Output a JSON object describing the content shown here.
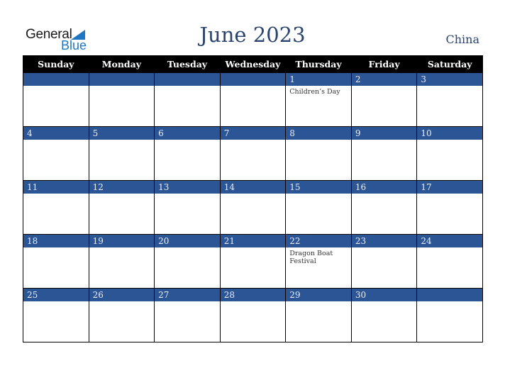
{
  "logo": {
    "line1": "General",
    "line2": "Blue"
  },
  "header": {
    "title": "June 2023",
    "country": "China"
  },
  "colors": {
    "accent": "#2c5596",
    "title": "#2b4470",
    "header_bg": "#000000"
  },
  "weekdays": [
    "Sunday",
    "Monday",
    "Tuesday",
    "Wednesday",
    "Thursday",
    "Friday",
    "Saturday"
  ],
  "weeks": [
    [
      {
        "day": "",
        "event": ""
      },
      {
        "day": "",
        "event": ""
      },
      {
        "day": "",
        "event": ""
      },
      {
        "day": "",
        "event": ""
      },
      {
        "day": "1",
        "event": "Children’s Day"
      },
      {
        "day": "2",
        "event": ""
      },
      {
        "day": "3",
        "event": ""
      }
    ],
    [
      {
        "day": "4",
        "event": ""
      },
      {
        "day": "5",
        "event": ""
      },
      {
        "day": "6",
        "event": ""
      },
      {
        "day": "7",
        "event": ""
      },
      {
        "day": "8",
        "event": ""
      },
      {
        "day": "9",
        "event": ""
      },
      {
        "day": "10",
        "event": ""
      }
    ],
    [
      {
        "day": "11",
        "event": ""
      },
      {
        "day": "12",
        "event": ""
      },
      {
        "day": "13",
        "event": ""
      },
      {
        "day": "14",
        "event": ""
      },
      {
        "day": "15",
        "event": ""
      },
      {
        "day": "16",
        "event": ""
      },
      {
        "day": "17",
        "event": ""
      }
    ],
    [
      {
        "day": "18",
        "event": ""
      },
      {
        "day": "19",
        "event": ""
      },
      {
        "day": "20",
        "event": ""
      },
      {
        "day": "21",
        "event": ""
      },
      {
        "day": "22",
        "event": "Dragon Boat Festival"
      },
      {
        "day": "23",
        "event": ""
      },
      {
        "day": "24",
        "event": ""
      }
    ],
    [
      {
        "day": "25",
        "event": ""
      },
      {
        "day": "26",
        "event": ""
      },
      {
        "day": "27",
        "event": ""
      },
      {
        "day": "28",
        "event": ""
      },
      {
        "day": "29",
        "event": ""
      },
      {
        "day": "30",
        "event": ""
      },
      {
        "day": "",
        "event": ""
      }
    ]
  ]
}
